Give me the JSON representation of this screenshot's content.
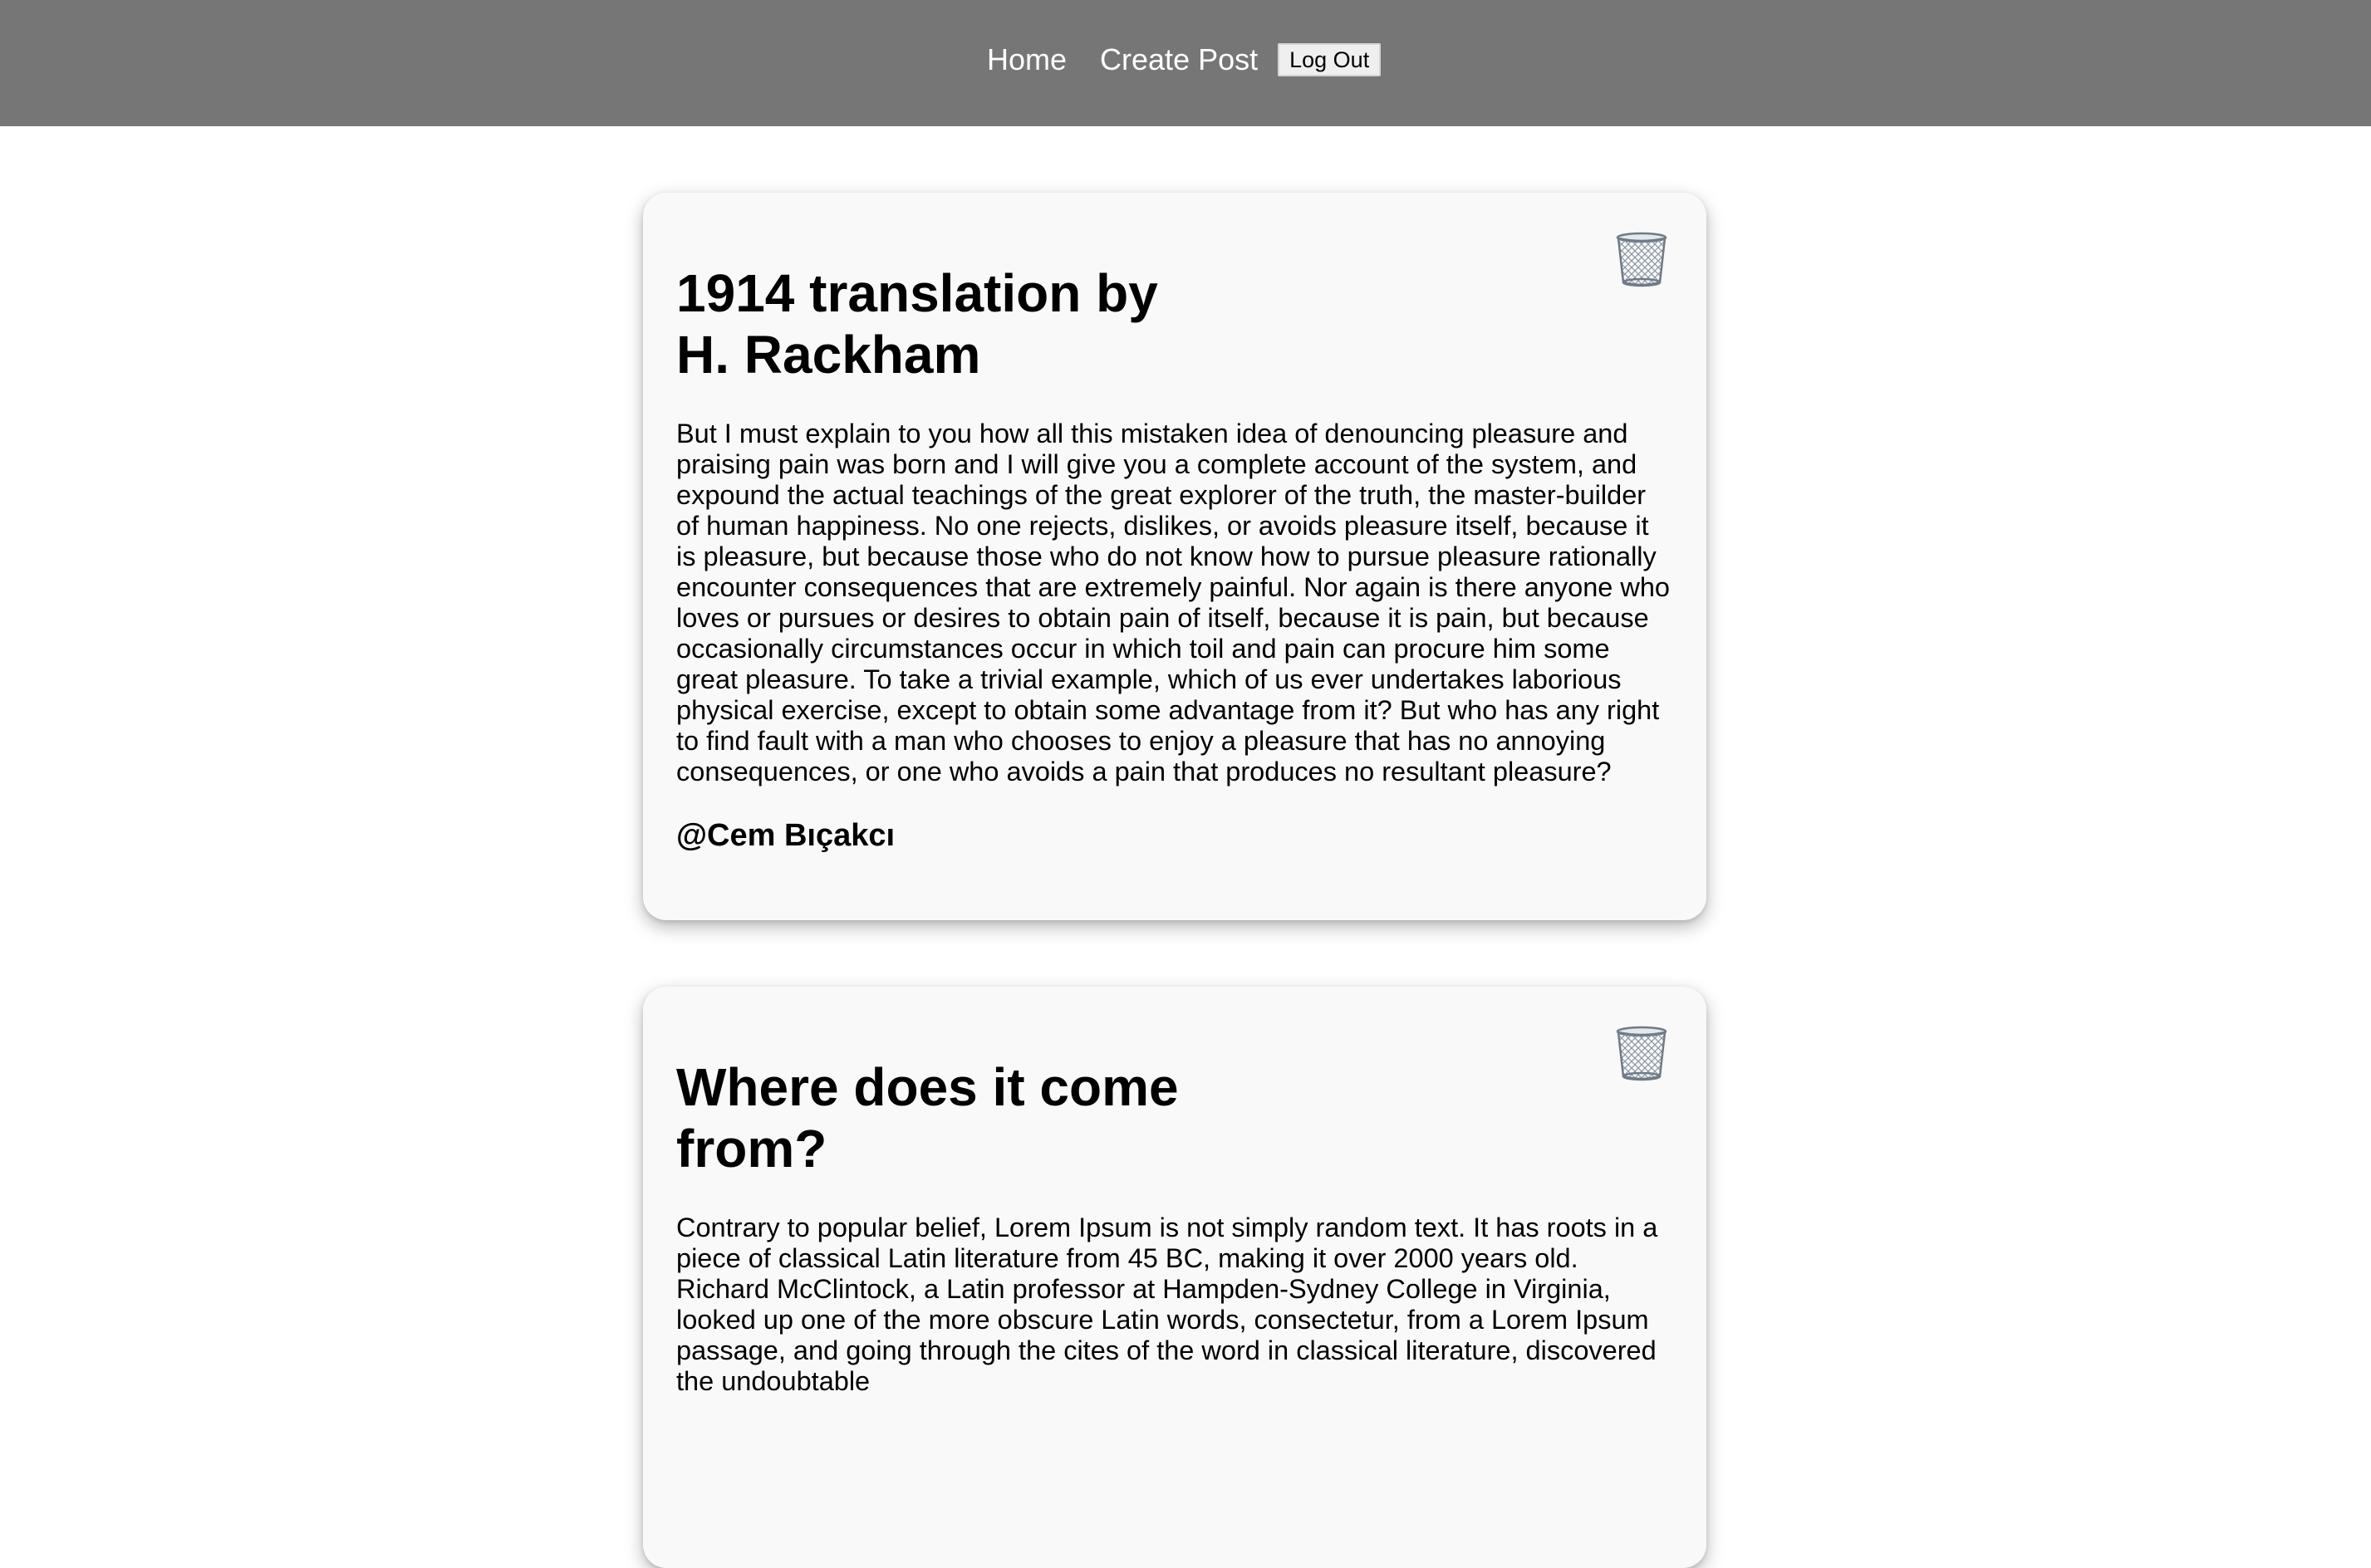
{
  "nav": {
    "home_label": "Home",
    "create_post_label": "Create Post",
    "logout_label": "Log Out"
  },
  "posts": [
    {
      "title": "1914 translation by H. Rackham",
      "body": "But I must explain to you how all this mistaken idea of denouncing pleasure and praising pain was born and I will give you a complete account of the system, and expound the actual teachings of the great explorer of the truth, the master-builder of human happiness. No one rejects, dislikes, or avoids pleasure itself, because it is pleasure, but because those who do not know how to pursue pleasure rationally encounter consequences that are extremely painful. Nor again is there anyone who loves or pursues or desires to obtain pain of itself, because it is pain, but because occasionally circumstances occur in which toil and pain can procure him some great pleasure. To take a trivial example, which of us ever undertakes laborious physical exercise, except to obtain some advantage from it? But who has any right to find fault with a man who chooses to enjoy a pleasure that has no annoying consequences, or one who avoids a pain that produces no resultant pleasure?",
      "author": "@Cem Bıçakcı",
      "delete_icon": "trash-icon"
    },
    {
      "title": "Where does it come from?",
      "body": "Contrary to popular belief, Lorem Ipsum is not simply random text. It has roots in a piece of classical Latin literature from 45 BC, making it over 2000 years old. Richard McClintock, a Latin professor at Hampden-Sydney College in Virginia, looked up one of the more obscure Latin words, consectetur, from a Lorem Ipsum passage, and going through the cites of the word in classical literature, discovered the undoubtable",
      "delete_icon": "trash-icon"
    }
  ],
  "colors": {
    "navbar_bg": "#767676",
    "card_bg": "#f9f9f9",
    "trash_icon": "#7e8b99"
  }
}
